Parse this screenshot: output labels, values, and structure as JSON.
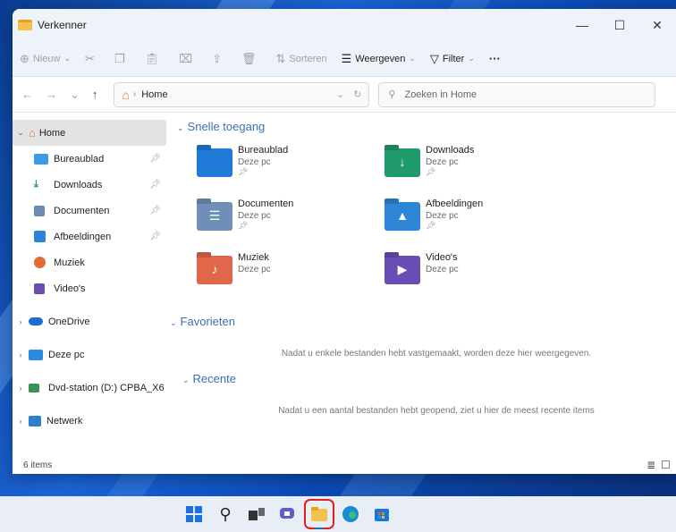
{
  "window": {
    "title": "Verkenner",
    "minimize": "—",
    "maximize": "☐",
    "close": "✕"
  },
  "commandbar": {
    "new_label": "Nieuw",
    "sort_label": "Sorteren",
    "view_label": "Weergeven",
    "filter_label": "Filter",
    "more_label": "···"
  },
  "address": {
    "path": "Home",
    "search_placeholder": "Zoeken in Home"
  },
  "sidebar": {
    "home": "Home",
    "quick": [
      {
        "label": "Bureaublad",
        "color": "#3a9be8"
      },
      {
        "label": "Downloads",
        "color": "#1e9e5a"
      },
      {
        "label": "Documenten",
        "color": "#6e8cb3"
      },
      {
        "label": "Afbeeldingen",
        "color": "#2b84d8"
      },
      {
        "label": "Muziek",
        "color": "#e46a3a"
      },
      {
        "label": "Video's",
        "color": "#6a4fb0"
      }
    ],
    "onedrive": "OneDrive",
    "this_pc": "Deze pc",
    "dvd": "Dvd-station (D:) CPBA_X6",
    "network": "Netwerk"
  },
  "content": {
    "quick_access_title": "Snelle toegang",
    "favorites_title": "Favorieten",
    "favorites_empty": "Nadat u enkele bestanden hebt vastgemaakt, worden deze hier weergegeven.",
    "recent_title": "Recente",
    "recent_empty": "Nadat u een aantal bestanden hebt geopend, ziet u hier de meest recente items",
    "tiles": [
      {
        "name": "Bureaublad",
        "sub": "Deze pc",
        "pinned": true,
        "color": "#1f7ad8"
      },
      {
        "name": "Downloads",
        "sub": "Deze pc",
        "pinned": true,
        "color": "#1f9a6a"
      },
      {
        "name": "Documenten",
        "sub": "Deze pc",
        "pinned": true,
        "color": "#6f8fb8"
      },
      {
        "name": "Afbeeldingen",
        "sub": "Deze pc",
        "pinned": true,
        "color": "#2e86d6"
      },
      {
        "name": "Muziek",
        "sub": "Deze pc",
        "pinned": false,
        "color": "#e1674a"
      },
      {
        "name": "Video's",
        "sub": "Deze pc",
        "pinned": false,
        "color": "#6a4db4"
      }
    ]
  },
  "status": {
    "items": "6 items"
  }
}
